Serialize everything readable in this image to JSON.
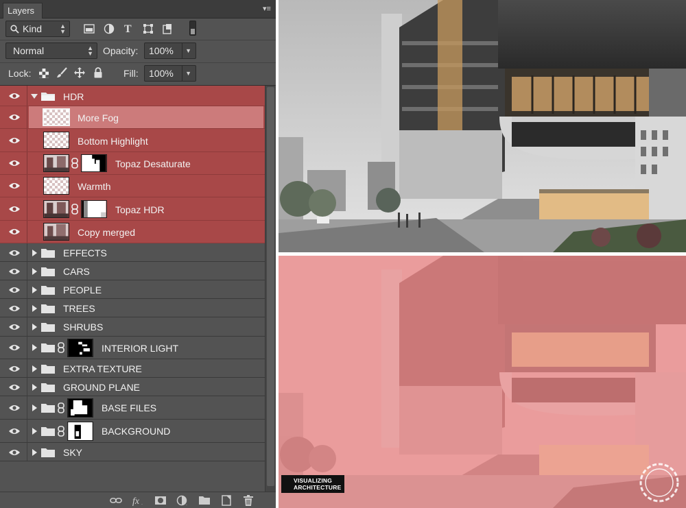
{
  "panel": {
    "tab_title": "Layers",
    "filter": {
      "label": "Kind"
    },
    "blend_mode": "Normal",
    "opacity_label": "Opacity:",
    "opacity_value": "100%",
    "lock_label": "Lock:",
    "fill_label": "Fill:",
    "fill_value": "100%"
  },
  "layers": [
    {
      "name": "HDR",
      "type": "group",
      "expanded": true
    },
    {
      "name": "More Fog",
      "type": "layer",
      "selected": true
    },
    {
      "name": "Bottom Highlight",
      "type": "layer"
    },
    {
      "name": "Topaz Desaturate",
      "type": "layer",
      "masked": true
    },
    {
      "name": "Warmth",
      "type": "layer"
    },
    {
      "name": "Topaz HDR",
      "type": "layer",
      "masked": true
    },
    {
      "name": "Copy merged",
      "type": "layer"
    },
    {
      "name": "EFFECTS",
      "type": "group"
    },
    {
      "name": "CARS",
      "type": "group"
    },
    {
      "name": "PEOPLE",
      "type": "group"
    },
    {
      "name": "TREES",
      "type": "group"
    },
    {
      "name": "SHRUBS",
      "type": "group"
    },
    {
      "name": "INTERIOR LIGHT",
      "type": "group",
      "masked": true
    },
    {
      "name": "EXTRA TEXTURE",
      "type": "group"
    },
    {
      "name": "GROUND PLANE",
      "type": "group"
    },
    {
      "name": "BASE FILES",
      "type": "group",
      "masked": true
    },
    {
      "name": "BACKGROUND",
      "type": "group",
      "masked": true
    },
    {
      "name": "SKY",
      "type": "group"
    }
  ],
  "badge": {
    "line1": "VISUALIZING",
    "line2": "ARCHITECTURE"
  },
  "colors": {
    "panel": "#535353",
    "highlight_red": "#a84848",
    "selected_row": "#cc7b7b",
    "overlay_red": "#e79b9b"
  }
}
